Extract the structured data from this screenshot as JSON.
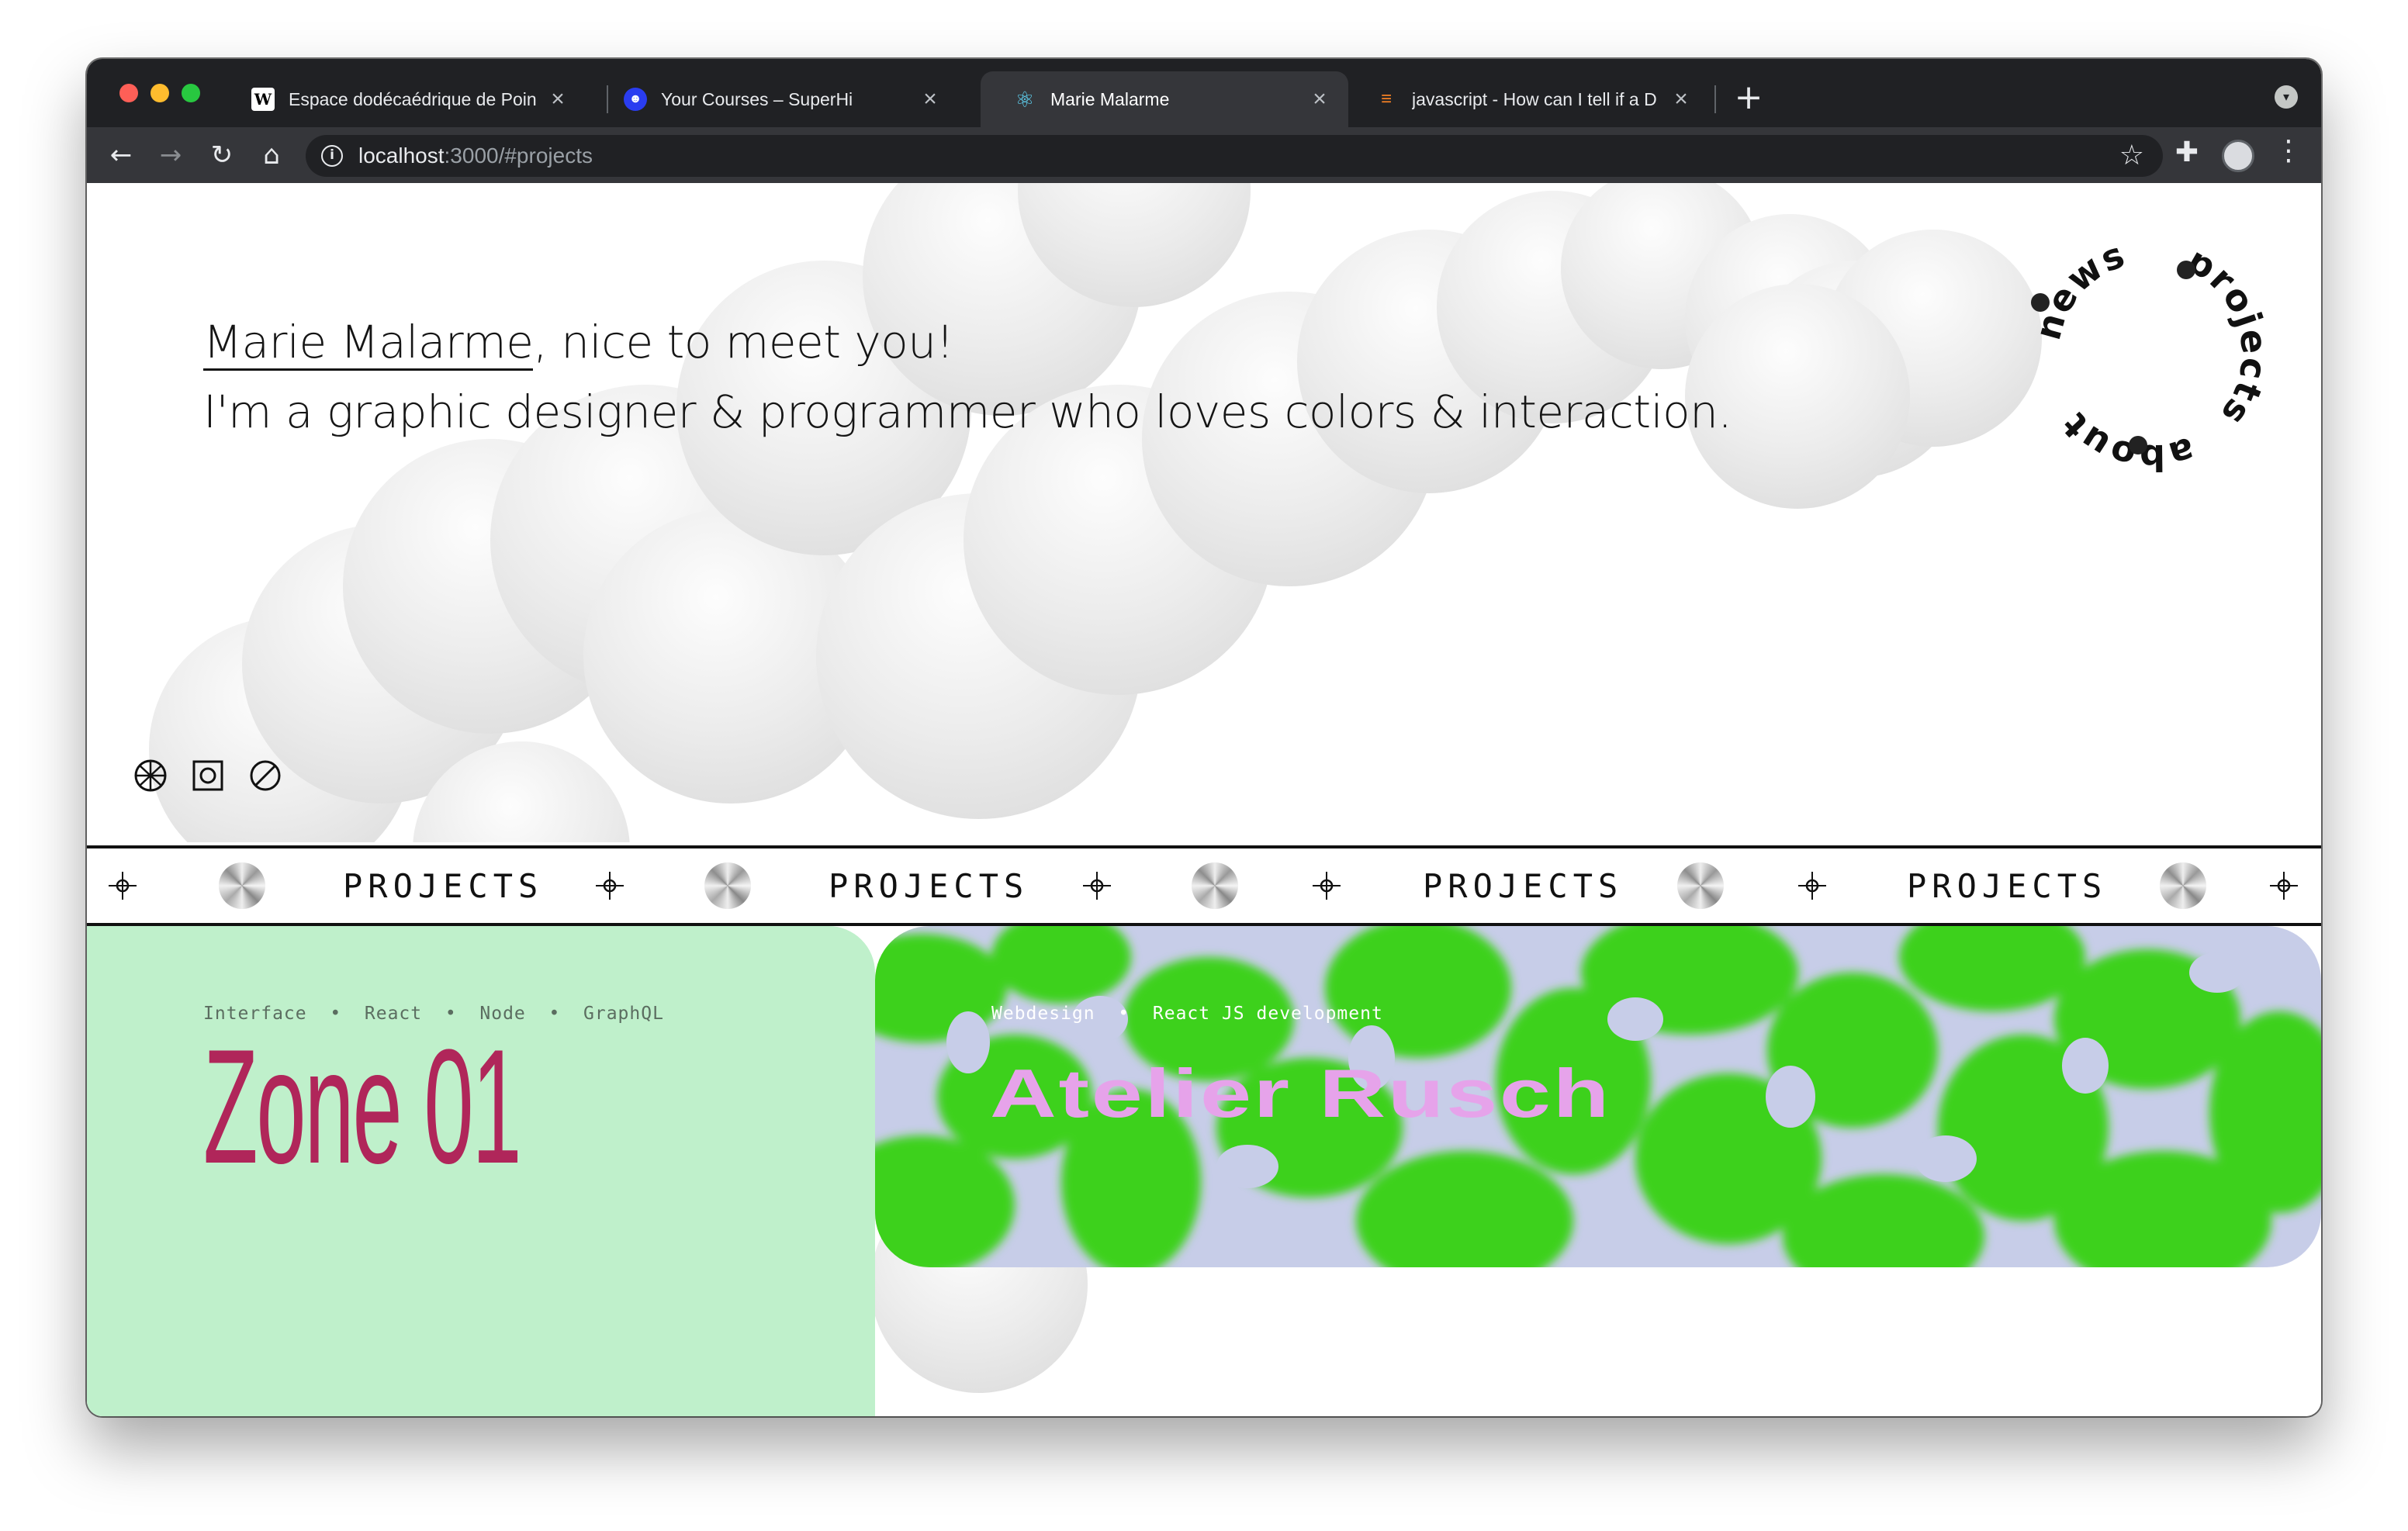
{
  "browser": {
    "tabs": [
      {
        "title": "Espace dodécaédrique de Poin",
        "favicon": "wikipedia-icon",
        "active": false
      },
      {
        "title": "Your Courses – SuperHi",
        "favicon": "superhi-smiley-icon",
        "active": false
      },
      {
        "title": "Marie Malarme",
        "favicon": "react-atom-icon",
        "active": true
      },
      {
        "title": "javascript - How can I tell if a D",
        "favicon": "stackoverflow-icon",
        "active": false
      }
    ],
    "url_host": "localhost",
    "url_rest": ":3000/#projects"
  },
  "hero": {
    "name": "Marie Malarme",
    "greeting_rest": ", nice to meet you!",
    "line2": "I'm a graphic designer & programmer who loves colors & interaction.",
    "nav_ring": [
      "news",
      "projects",
      "about"
    ],
    "icons": [
      "dribbble-icon",
      "instagram-icon",
      "no-entry-icon"
    ]
  },
  "marquee": {
    "word": "PROJECTS"
  },
  "projects": [
    {
      "tags": [
        "Interface",
        "React",
        "Node",
        "GraphQL"
      ],
      "title": "Zone 01",
      "bg": "#bff0cb",
      "title_color": "#b0265a"
    },
    {
      "tags": [
        "Webdesign",
        "React JS development"
      ],
      "title": "Atelier Rusch",
      "title_color": "#e6a3ea",
      "pattern_colors": [
        "#3dd11b",
        "#c7cde8"
      ]
    }
  ],
  "colors": {
    "chrome_dark": "#202124",
    "chrome_toolbar": "#35363a"
  }
}
